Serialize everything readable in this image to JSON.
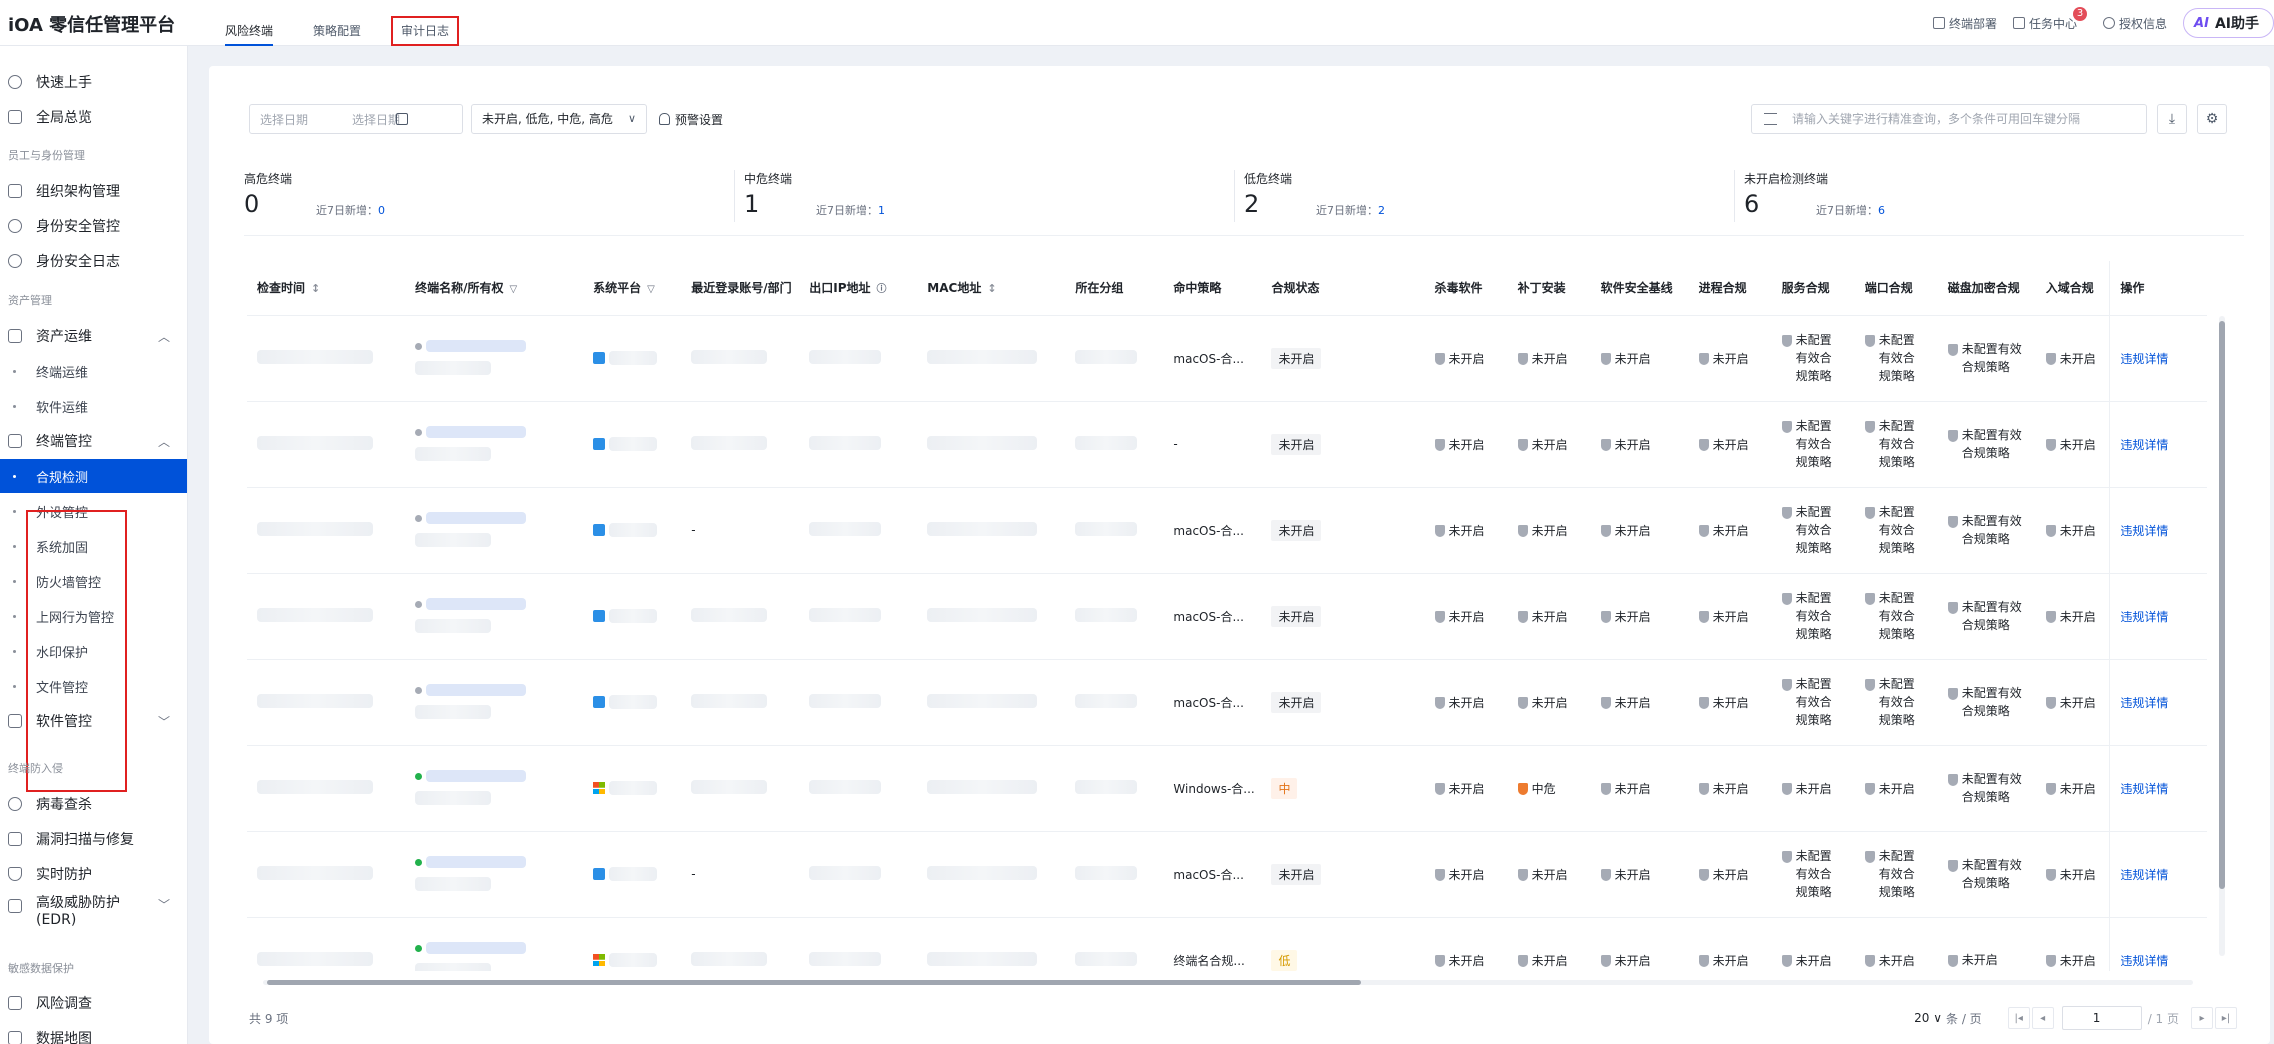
{
  "app": {
    "title": "iOA 零信任管理平台"
  },
  "top_tabs": [
    "风险终端",
    "策略配置",
    "审计日志"
  ],
  "header_right": {
    "deploy": "终端部署",
    "tasks": "任务中心",
    "task_badge": "3",
    "license": "授权信息",
    "ai": "AI助手",
    "ai_logo": "AI"
  },
  "sidebar": {
    "quick_start": "快速上手",
    "overview": "全局总览",
    "sec_identity": "员工与身份管理",
    "org": "组织架构管理",
    "identity_ctrl": "身份安全管控",
    "identity_log": "身份安全日志",
    "sec_asset": "资产管理",
    "asset_ops": "资产运维",
    "terminal_ops": "终端运维",
    "software_ops": "软件运维",
    "terminal_ctrl": "终端管控",
    "compliance": "合规检测",
    "peripheral": "外设管控",
    "hardening": "系统加固",
    "firewall": "防火墙管控",
    "web_behavior": "上网行为管控",
    "watermark": "水印保护",
    "file_ctrl": "文件管控",
    "software_ctrl": "软件管控",
    "sec_intrusion": "终端防入侵",
    "antivirus": "病毒查杀",
    "vuln": "漏洞扫描与修复",
    "realtime": "实时防护",
    "edr": "高级威胁防护",
    "edr2": "(EDR)",
    "sec_sensitive": "敏感数据保护",
    "risk_survey": "风险调查",
    "data_map": "数据地图"
  },
  "filters": {
    "date_start": "选择日期",
    "date_end": "选择日期",
    "risk_select": "未开启, 低危, 中危, 高危",
    "alarm": "预警设置",
    "search_placeholder": "请输入关键字进行精准查询，多个条件可用回车键分隔"
  },
  "stats": [
    {
      "title": "高危终端",
      "count": "0",
      "new_label": "近7日新增：",
      "new_count": "0"
    },
    {
      "title": "中危终端",
      "count": "1",
      "new_label": "近7日新增：",
      "new_count": "1"
    },
    {
      "title": "低危终端",
      "count": "2",
      "new_label": "近7日新增：",
      "new_count": "2"
    },
    {
      "title": "未开启检测终端",
      "count": "6",
      "new_label": "近7日新增：",
      "new_count": "6"
    }
  ],
  "table": {
    "headers": [
      "检查时间",
      "终端名称/所有权",
      "系统平台",
      "最近登录账号/部门",
      "出口IP地址",
      "MAC地址",
      "所在分组",
      "命中策略",
      "合规状态",
      "杀毒软件",
      "补丁安装",
      "软件安全基线",
      "进程合规",
      "服务合规",
      "端口合规",
      "磁盘加密合规",
      "入域合规",
      "操作"
    ],
    "rows": [
      {
        "os": "mac",
        "online": "gray",
        "policy": "macOS-合...",
        "status": "未开启",
        "status_type": "off",
        "av": "未开启",
        "patch": "未开启",
        "patch_type": "gray",
        "baseline": "未开启",
        "process": "未开启",
        "service": "未配置有效合规策略",
        "port": "未配置有效合规策略",
        "disk": "未配置有效合规策略",
        "domain": "未开启",
        "action": "违规详情",
        "login": ""
      },
      {
        "os": "mac",
        "online": "gray",
        "policy": "-",
        "status": "未开启",
        "status_type": "off",
        "av": "未开启",
        "patch": "未开启",
        "patch_type": "gray",
        "baseline": "未开启",
        "process": "未开启",
        "service": "未配置有效合规策略",
        "port": "未配置有效合规策略",
        "disk": "未配置有效合规策略",
        "domain": "未开启",
        "action": "违规详情",
        "login": ""
      },
      {
        "os": "mac",
        "online": "gray",
        "policy": "macOS-合...",
        "status": "未开启",
        "status_type": "off",
        "av": "未开启",
        "patch": "未开启",
        "patch_type": "gray",
        "baseline": "未开启",
        "process": "未开启",
        "service": "未配置有效合规策略",
        "port": "未配置有效合规策略",
        "disk": "未配置有效合规策略",
        "domain": "未开启",
        "action": "违规详情",
        "login": "-"
      },
      {
        "os": "mac",
        "online": "gray",
        "policy": "macOS-合...",
        "status": "未开启",
        "status_type": "off",
        "av": "未开启",
        "patch": "未开启",
        "patch_type": "gray",
        "baseline": "未开启",
        "process": "未开启",
        "service": "未配置有效合规策略",
        "port": "未配置有效合规策略",
        "disk": "未配置有效合规策略",
        "domain": "未开启",
        "action": "违规详情",
        "login": ""
      },
      {
        "os": "mac",
        "online": "gray",
        "policy": "macOS-合...",
        "status": "未开启",
        "status_type": "off",
        "av": "未开启",
        "patch": "未开启",
        "patch_type": "gray",
        "baseline": "未开启",
        "process": "未开启",
        "service": "未配置有效合规策略",
        "port": "未配置有效合规策略",
        "disk": "未配置有效合规策略",
        "domain": "未开启",
        "action": "违规详情",
        "login": ""
      },
      {
        "os": "win",
        "online": "green",
        "policy": "Windows-合...",
        "status": "中",
        "status_type": "mid",
        "av": "未开启",
        "patch": "中危",
        "patch_type": "orange",
        "baseline": "未开启",
        "process": "未开启",
        "service": "未开启",
        "port": "未开启",
        "disk": "未配置有效合规策略",
        "domain": "未开启",
        "action": "违规详情",
        "login": ""
      },
      {
        "os": "mac",
        "online": "green",
        "policy": "macOS-合...",
        "status": "未开启",
        "status_type": "off",
        "av": "未开启",
        "patch": "未开启",
        "patch_type": "gray",
        "baseline": "未开启",
        "process": "未开启",
        "service": "未配置有效合规策略",
        "port": "未配置有效合规策略",
        "disk": "未配置有效合规策略",
        "domain": "未开启",
        "action": "违规详情",
        "login": "-"
      },
      {
        "os": "win",
        "online": "green",
        "policy": "终端名合规...",
        "status": "低",
        "status_type": "low",
        "av": "未开启",
        "patch": "未开启",
        "patch_type": "gray",
        "baseline": "未开启",
        "process": "未开启",
        "service": "未开启",
        "port": "未开启",
        "disk": "未开启",
        "domain": "未开启",
        "action": "违规详情",
        "login": ""
      }
    ]
  },
  "footer": {
    "total": "共 9 项",
    "page_size": "20",
    "per_page": "条 / 页",
    "current_page": "1",
    "page_of": "/ 1 页"
  }
}
